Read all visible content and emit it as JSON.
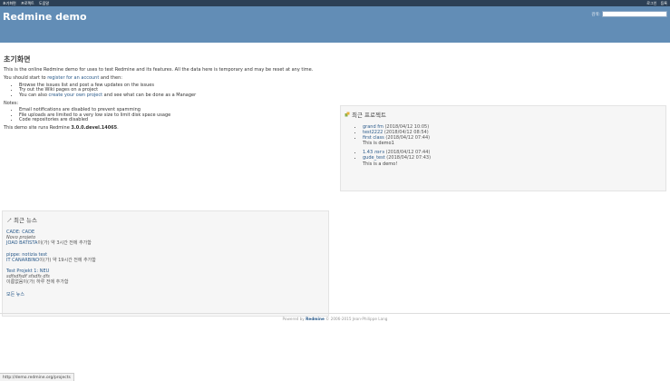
{
  "top_menu": {
    "left": [
      "초기화면",
      "프로젝트",
      "도움말"
    ],
    "right": [
      "로그인",
      "등록"
    ]
  },
  "header": {
    "title": "Redmine demo",
    "search_label": "검색:",
    "search_value": ""
  },
  "page_title": "초기화면",
  "intro": {
    "p1": "This is the online Redmine demo for uses to test Redmine and its features. All the data here is temporary and may be reset at any time.",
    "p2_before": "You should start to ",
    "p2_link": "register for an account",
    "p2_after": " and then:",
    "steps": [
      {
        "text": "Browse the issues list and post a few updates on the issues"
      },
      {
        "text": "Try out the Wiki pages on a project"
      },
      {
        "before": "You can also ",
        "link": "create your own project",
        "after": " and see what can be done as a Manager"
      }
    ],
    "notes_label": "Notes:",
    "notes": [
      "Email notifications are disabled to prevent spamming",
      "File uploads are limited to a very low size to limit disk space usage",
      "Code repositories are disabled"
    ],
    "version_before": "This demo site runs Redmine ",
    "version": "3.0.0.devel.14065",
    "version_after": "."
  },
  "news": {
    "title": "최근 뉴스",
    "items": [
      {
        "title": "CADE: CADE",
        "summary": "Novo projeto",
        "author": "JOAO BATISTA",
        "meta": "이(가) 약 3시간 전에 추가함"
      },
      {
        "title": "pippe: notizia test",
        "summary": "",
        "author": "IT CANARBINO",
        "meta": "이(가) 약 19시간 전에 추가함"
      },
      {
        "title": "Test Projekt 1: NEU",
        "summary": "sdfsdfsdf sfsdfs dfs",
        "author": "",
        "meta": "이름없음이(가) 하루 전에 추가함"
      }
    ],
    "all_link": "모든 뉴스"
  },
  "projects": {
    "title": "최근 프로젝트",
    "groups": [
      [
        {
          "name": "grand fm",
          "date": "(2018/04/12 10:05)",
          "desc": ""
        },
        {
          "name": "test2222",
          "date": "(2018/04/12 08:54)",
          "desc": ""
        },
        {
          "name": "first class",
          "date": "(2018/04/12 07:44)",
          "desc": "This is demo1"
        }
      ],
      [
        {
          "name": "1.43 лэгэ",
          "date": "(2018/04/12 07:44)",
          "desc": ""
        },
        {
          "name": "gude_test",
          "date": "(2018/04/12 07:43)",
          "desc": "This is a demo!"
        }
      ]
    ]
  },
  "footer": {
    "before": "Powered by ",
    "brand": "Redmine",
    "after": " © 2006-2015 Jean-Philippe Lang"
  },
  "status_bar": "http://demo.redmine.org/projects"
}
